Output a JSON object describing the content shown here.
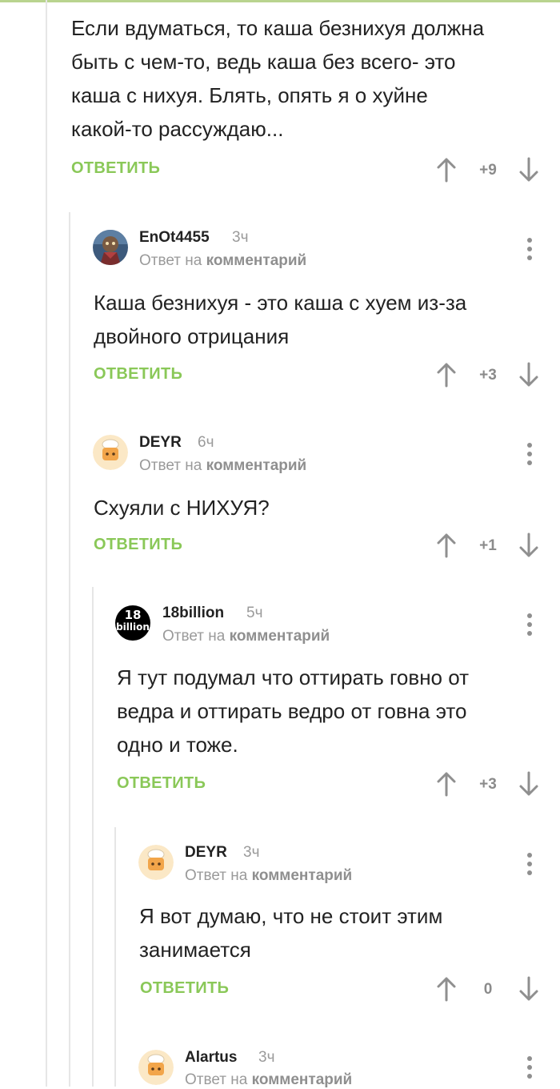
{
  "colors": {
    "accent": "#8ac858",
    "muted": "#9a9a9a",
    "text": "#222222",
    "thread_line": "#e6e6e6"
  },
  "icons": {
    "upvote": "arrow-up-icon",
    "downvote": "arrow-down-icon",
    "menu": "more-vertical-icon"
  },
  "comments": [
    {
      "text": "Если вдуматься, то каша безнихуя должна\nбыть с чем-то, ведь каша без всего- это\nкаша с нихуя. Блять, опять я о хуйне\nкакой-то рассуждаю...",
      "reply_label": "ОТВЕТИТЬ",
      "score": "+9"
    },
    {
      "username": "EnOt4455",
      "time": "3ч",
      "reply_prefix": "Ответ на",
      "reply_target": "комментарий",
      "text": "Каша безнихуя - это каша с хуем из-за\nдвойного отрицания",
      "reply_label": "ОТВЕТИТЬ",
      "score": "+3"
    },
    {
      "username": "DEYR",
      "time": "6ч",
      "reply_prefix": "Ответ на",
      "reply_target": "комментарий",
      "text": "Схуяли с НИХУЯ?",
      "reply_label": "ОТВЕТИТЬ",
      "score": "+1"
    },
    {
      "username": "18billion",
      "avatar_text": "18",
      "avatar_text2": "billion",
      "time": "5ч",
      "reply_prefix": "Ответ на",
      "reply_target": "комментарий",
      "text": "Я тут подумал что оттирать говно от\nведра и оттирать ведро от говна это\nодно и тоже.",
      "reply_label": "ОТВЕТИТЬ",
      "score": "+3"
    },
    {
      "username": "DEYR",
      "time": "3ч",
      "reply_prefix": "Ответ на",
      "reply_target": "комментарий",
      "text": "Я вот думаю, что не стоит этим\nзанимается",
      "reply_label": "ОТВЕТИТЬ",
      "score": "0"
    },
    {
      "username": "Alartus",
      "time": "3ч",
      "reply_prefix": "Ответ на",
      "reply_target": "комментарий"
    }
  ]
}
